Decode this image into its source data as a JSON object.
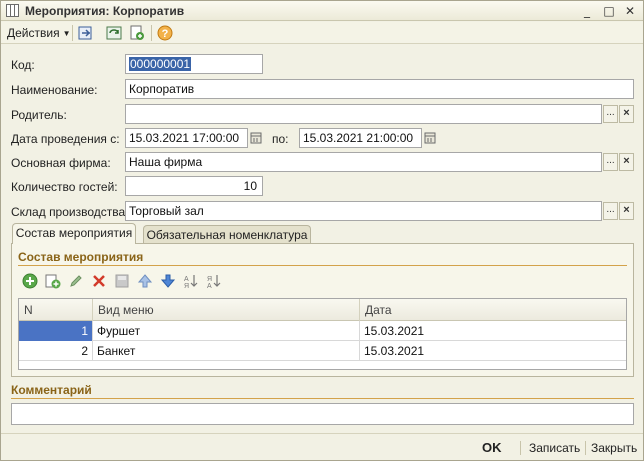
{
  "window": {
    "title": "Мероприятия: Корпоратив",
    "controls": {
      "minimize": "_",
      "maximize": "□",
      "close": "✕"
    }
  },
  "toolbar": {
    "actions_label": "Действия",
    "icons": [
      "post-and-close-icon",
      "refresh-icon",
      "copy-new-icon",
      "help-icon"
    ]
  },
  "form": {
    "code": {
      "label": "Код:",
      "value": "000000001"
    },
    "name": {
      "label": "Наименование:",
      "value": "Корпоратив"
    },
    "parent": {
      "label": "Родитель:",
      "value": ""
    },
    "date": {
      "label": "Дата проведения с:",
      "from": "15.03.2021 17:00:00",
      "to_label": "по:",
      "to": "15.03.2021 21:00:00"
    },
    "company": {
      "label": "Основная фирма:",
      "value": "Наша фирма"
    },
    "guests": {
      "label": "Количество гостей:",
      "value": "10"
    },
    "warehouse": {
      "label": "Склад производства:",
      "value": "Торговый зал"
    },
    "select_button": "...",
    "clear_button": "×"
  },
  "tabs": [
    {
      "label": "Состав мероприятия",
      "active": true
    },
    {
      "label": "Обязательная номенклатура",
      "active": false
    }
  ],
  "composition": {
    "title": "Состав мероприятия",
    "tools": [
      "add-icon",
      "add-copy-icon",
      "edit-icon",
      "delete-icon",
      "end-edit-icon",
      "move-up-icon",
      "move-down-icon",
      "sort-asc-icon",
      "sort-desc-icon"
    ],
    "columns": [
      "N",
      "Вид меню",
      "Дата"
    ],
    "rows": [
      {
        "n": "1",
        "menu": "Фуршет",
        "date": "15.03.2021",
        "selected": true
      },
      {
        "n": "2",
        "menu": "Банкет",
        "date": "15.03.2021",
        "selected": false
      }
    ]
  },
  "comment": {
    "title": "Комментарий",
    "value": ""
  },
  "footer": {
    "ok": "OK",
    "save": "Записать",
    "close": "Закрыть"
  },
  "colors": {
    "section_title": "#8a6418",
    "selection": "#4a73c4",
    "window_bg": "#f2f1e4"
  }
}
